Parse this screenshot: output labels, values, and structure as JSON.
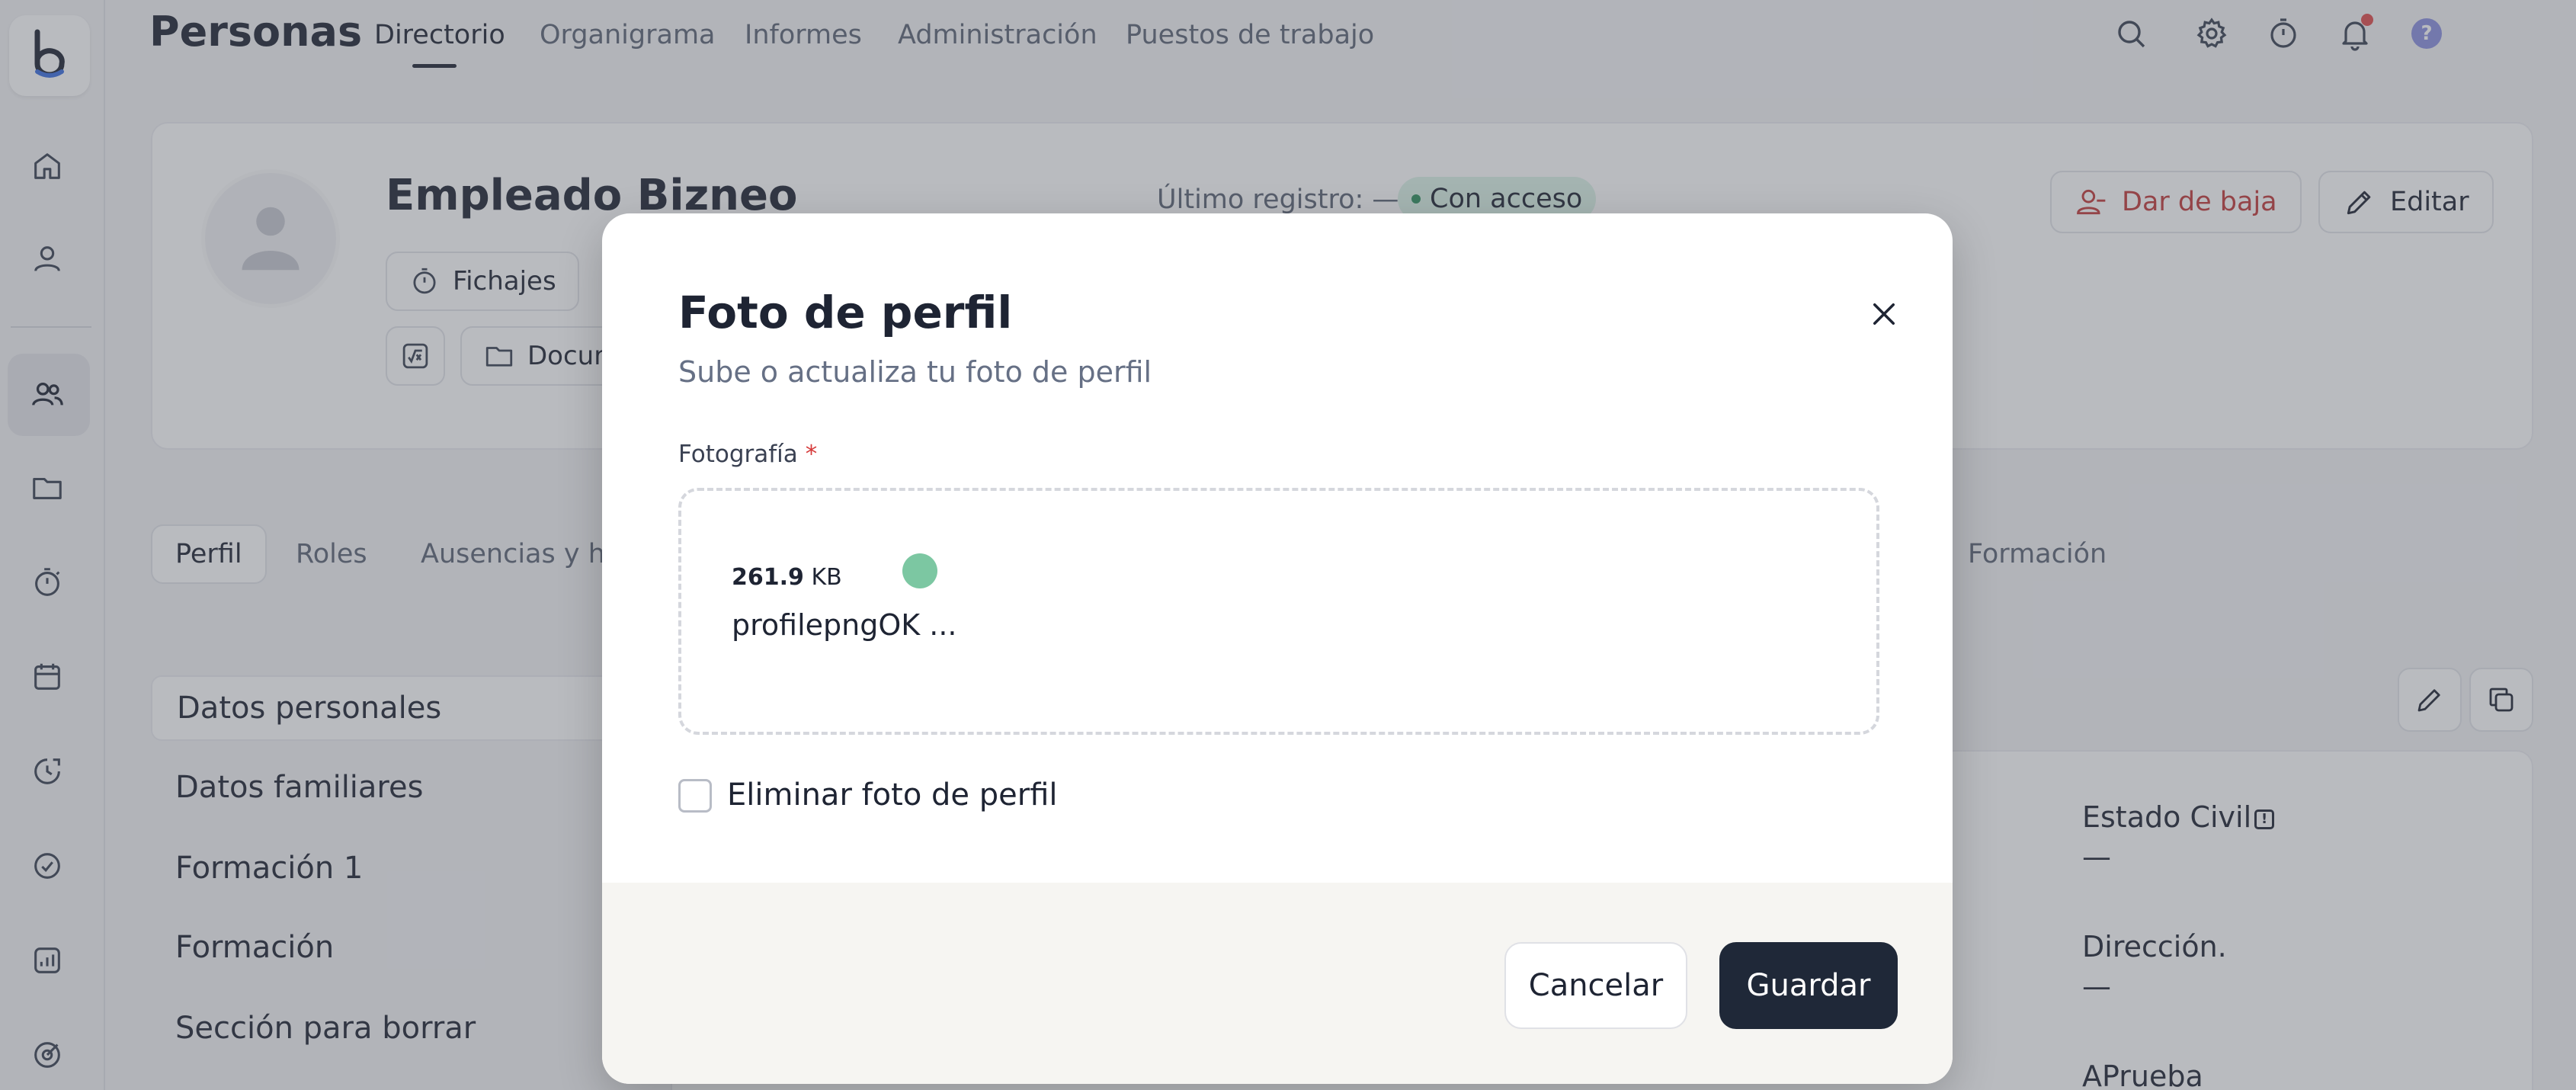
{
  "app": {
    "title": "Personas",
    "logo_letter": "b"
  },
  "nav": {
    "items": [
      {
        "label": "Directorio",
        "active": true
      },
      {
        "label": "Organigrama"
      },
      {
        "label": "Informes"
      },
      {
        "label": "Administración"
      },
      {
        "label": "Puestos de trabajo"
      }
    ],
    "help_label": "?"
  },
  "sidebar": {
    "icons": [
      "home-icon",
      "user-icon",
      "users-icon",
      "folder-icon",
      "stopwatch-icon",
      "calendar-icon",
      "clock-history-icon",
      "check-circle-icon",
      "chart-icon",
      "target-icon"
    ],
    "active": "users-icon"
  },
  "profile": {
    "name": "Empleado Bizneo",
    "last_registry": "Último registro: —",
    "access_badge": "Con acceso",
    "chips": [
      {
        "label": "Fichajes",
        "icon": "stopwatch-icon"
      },
      {
        "label": "Docur",
        "icon": "folder-icon"
      }
    ],
    "deactivate_label": "Dar de baja",
    "edit_label": "Editar"
  },
  "tabs": [
    {
      "label": "Perfil",
      "active": true
    },
    {
      "label": "Roles"
    },
    {
      "label": "Ausencias y ho"
    },
    {
      "label": "Formación"
    }
  ],
  "sections": [
    {
      "label": "Datos personales",
      "active": true
    },
    {
      "label": "Datos familiares"
    },
    {
      "label": "Formación 1"
    },
    {
      "label": "Formación"
    },
    {
      "label": "Sección para borrar"
    }
  ],
  "details": {
    "estado_civil_label": "Estado Civil",
    "estado_civil_value": "—",
    "info_glyph": "!",
    "direccion_label": "Dirección.",
    "direccion_value": "—",
    "aprueba_label": "APrueba"
  },
  "modal": {
    "title": "Foto de perfil",
    "subtitle": "Sube o actualiza tu foto de perfil",
    "field_label": "Fotografía",
    "required_mark": "*",
    "file_size_value": "261.9",
    "file_size_unit": "KB",
    "file_name": "profilepngOK ...",
    "remove_label": "Eliminar foto de perfil",
    "cancel_label": "Cancelar",
    "save_label": "Guardar"
  }
}
